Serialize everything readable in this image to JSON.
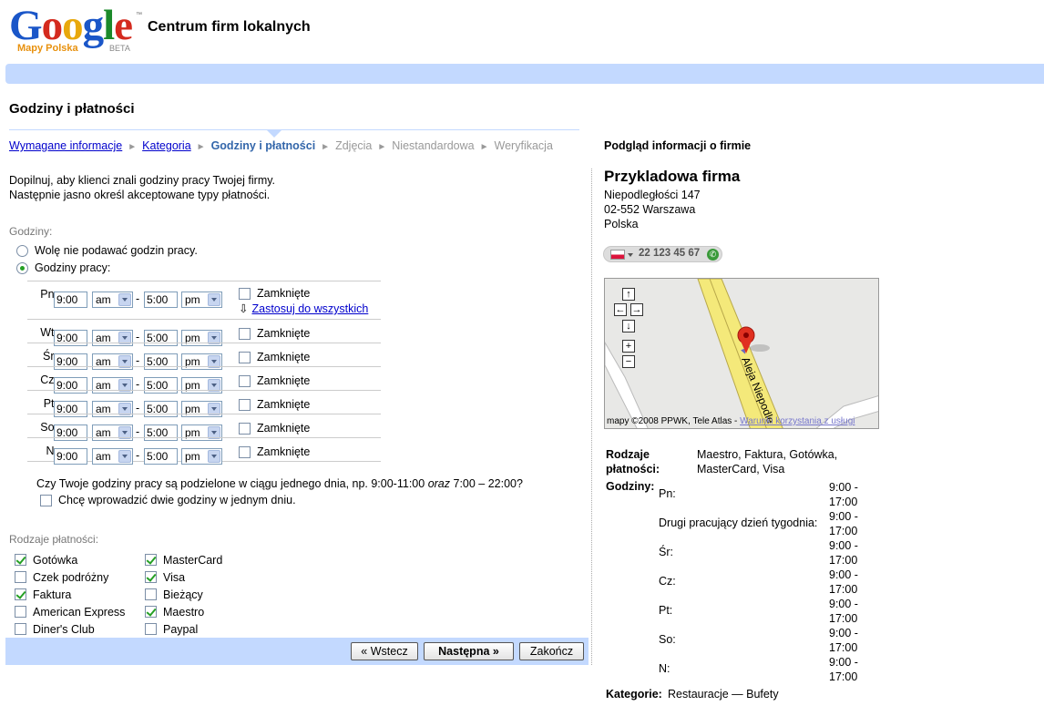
{
  "header": {
    "logo_word": "Google",
    "logo_sub": "Mapy Polska",
    "logo_beta": "BETA",
    "logo_tm": "™",
    "app_title": "Centrum firm lokalnych"
  },
  "page_title": "Godziny i płatności",
  "breadcrumb": {
    "step1": "Wymagane informacje",
    "step2": "Kategoria",
    "step3": "Godziny i płatności",
    "step4": "Zdjęcia",
    "step5": "Niestandardowa",
    "step6": "Weryfikacja",
    "sep": "►"
  },
  "intro": {
    "line1": "Dopilnuj, aby klienci znali godziny pracy Twojej firmy.",
    "line2": "Następnie jasno określ akceptowane typy płatności."
  },
  "hours": {
    "label": "Godziny:",
    "option_none": "Wolę nie podawać godzin pracy.",
    "option_hours": "Godziny pracy:",
    "closed_label": "Zamknięte",
    "apply_all": "Zastosuj do wszystkich",
    "apply_icon": "⇩",
    "dash": "-",
    "days": [
      {
        "day": "Pn:",
        "open": "9:00",
        "open_ampm": "am",
        "close": "5:00",
        "close_ampm": "pm"
      },
      {
        "day": "Wt:",
        "open": "9:00",
        "open_ampm": "am",
        "close": "5:00",
        "close_ampm": "pm"
      },
      {
        "day": "Śr:",
        "open": "9:00",
        "open_ampm": "am",
        "close": "5:00",
        "close_ampm": "pm"
      },
      {
        "day": "Cz:",
        "open": "9:00",
        "open_ampm": "am",
        "close": "5:00",
        "close_ampm": "pm"
      },
      {
        "day": "Pt:",
        "open": "9:00",
        "open_ampm": "am",
        "close": "5:00",
        "close_ampm": "pm"
      },
      {
        "day": "So:",
        "open": "9:00",
        "open_ampm": "am",
        "close": "5:00",
        "close_ampm": "pm"
      },
      {
        "day": "N:",
        "open": "9:00",
        "open_ampm": "am",
        "close": "5:00",
        "close_ampm": "pm"
      }
    ],
    "split_question_a": "Czy Twoje godziny pracy są podzielone w ciągu jednego dnia, np. 9:00-11:00 ",
    "split_question_em": "oraz",
    "split_question_b": " 7:00 – 22:00?",
    "split_option": "Chcę wprowadzić dwie godziny w jednym dniu."
  },
  "payments": {
    "label": "Rodzaje płatności:",
    "col1": [
      {
        "label": "Gotówka",
        "checked": "true"
      },
      {
        "label": "Czek podróżny",
        "checked": "false"
      },
      {
        "label": "Faktura",
        "checked": "true"
      },
      {
        "label": "American Express",
        "checked": "false"
      },
      {
        "label": "Diner's Club",
        "checked": "false"
      }
    ],
    "col2": [
      {
        "label": "MasterCard",
        "checked": "true"
      },
      {
        "label": "Visa",
        "checked": "true"
      },
      {
        "label": "Bieżący",
        "checked": "false"
      },
      {
        "label": "Maestro",
        "checked": "true"
      },
      {
        "label": "Paypal",
        "checked": "false"
      }
    ]
  },
  "buttons": {
    "back": "« Wstecz",
    "next": "Następna »",
    "finish": "Zakończ"
  },
  "preview": {
    "title": "Podgląd informacji o firmie",
    "business_name": "Przykladowa firma",
    "street": "Niepodległości 147",
    "city": "02-552 Warszawa",
    "country": "Polska",
    "phone": "22 123 45 67",
    "call_icon": "✆",
    "map_copyright": "mapy ©2008 PPWK, Tele Atlas - ",
    "map_terms": "Warunki korzystania z usługi",
    "map_street": "Aleja Niepodle",
    "pay_types_label": "Rodzaje płatności:",
    "pay_types_value": "Maestro, Faktura, Gotówka, MasterCard, Visa",
    "hours_label": "Godziny:",
    "hours": [
      {
        "day": "Pn:",
        "open": "9:00 -",
        "close": "17:00"
      },
      {
        "day": "Drugi pracujący dzień tygodnia:",
        "open": "9:00 -",
        "close": "17:00"
      },
      {
        "day": "Śr:",
        "open": "9:00 -",
        "close": "17:00"
      },
      {
        "day": "Cz:",
        "open": "9:00 -",
        "close": "17:00"
      },
      {
        "day": "Pt:",
        "open": "9:00 -",
        "close": "17:00"
      },
      {
        "day": "So:",
        "open": "9:00 -",
        "close": "17:00"
      },
      {
        "day": "N:",
        "open": "9:00 -",
        "close": "17:00"
      }
    ],
    "category_label": "Kategorie:",
    "category_value": "Restauracje — Bufety"
  },
  "map_controls": {
    "up": "↑",
    "left": "←",
    "right": "→",
    "down": "↓",
    "zoom_in": "+",
    "zoom_out": "−"
  },
  "colors": {
    "accent_bar": "#c3d9ff",
    "link": "#0000cc",
    "check": "#25a025",
    "google_blue": "#1a56c8",
    "google_red": "#d42a1e",
    "google_yellow": "#e8a80c",
    "google_green": "#1b8a2a"
  }
}
